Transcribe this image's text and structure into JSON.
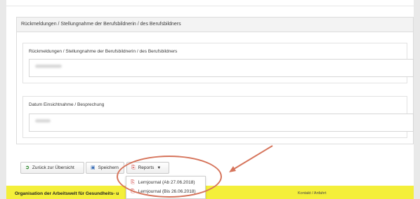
{
  "panel": {
    "header": "Rückmeldungen / Stellungnahme der Berufsbildnerin / des Berufsbildners",
    "feedback_label": "Rückmeldungen / Stellungnahme der Berufsbildnerin / des Berufsbildners",
    "date_label": "Datum Einsichtnahme / Besprechung"
  },
  "toolbar": {
    "back_label": "Zurück zur Übersicht",
    "save_label": "Speichern",
    "reports_label": "Reports"
  },
  "reports_menu": {
    "items": [
      {
        "label": "Lernjournal (Ab 27.06.2018)"
      },
      {
        "label": "Lernjournal (Bis 26.06.2018)"
      }
    ]
  },
  "footer": {
    "left": "Organisation der Arbeitswelt für Gesundheits- u",
    "right": "Kontakt / Anfahrt"
  },
  "colors": {
    "footer_bg": "#f4ef3a",
    "highlight": "#d6745b",
    "back_icon": "#2e8b2e",
    "save_icon": "#3b6fb6",
    "pdf_icon": "#cc3333"
  },
  "icons": {
    "back": "arrow-back-icon",
    "save": "save-icon",
    "reports": "pdf-icon",
    "caret": "caret-down-icon"
  }
}
